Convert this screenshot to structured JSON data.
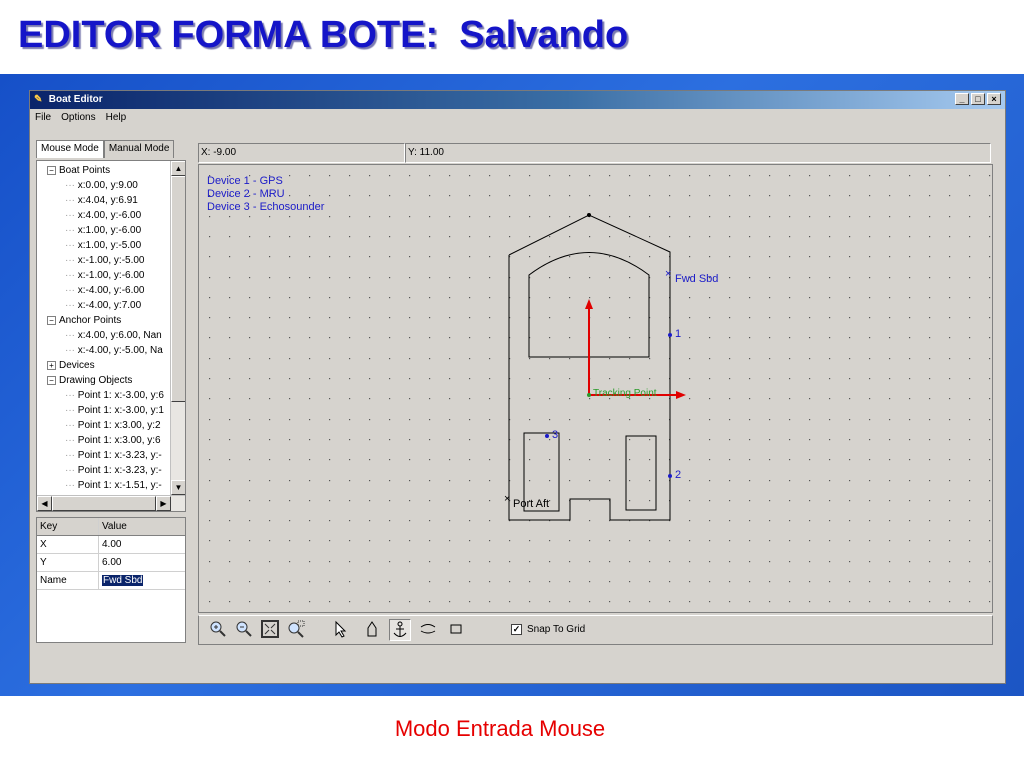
{
  "slide": {
    "title": "EDITOR FORMA BOTE:  Salvando",
    "caption": "Modo Entrada Mouse"
  },
  "window": {
    "title": "Boat Editor",
    "title_icon": "pencil-icon",
    "controls": [
      "_",
      "□",
      "×"
    ]
  },
  "menu": [
    "File",
    "Options",
    "Help"
  ],
  "tabs": [
    "Mouse Mode",
    "Manual Mode"
  ],
  "active_tab": "Mouse Mode",
  "tree": [
    {
      "label": "Boat Points",
      "level": 0,
      "expander": "-"
    },
    {
      "label": "x:0.00, y:9.00",
      "level": 1
    },
    {
      "label": "x:4.04, y:6.91",
      "level": 1
    },
    {
      "label": "x:4.00, y:-6.00",
      "level": 1
    },
    {
      "label": "x:1.00, y:-6.00",
      "level": 1
    },
    {
      "label": "x:1.00, y:-5.00",
      "level": 1
    },
    {
      "label": "x:-1.00, y:-5.00",
      "level": 1
    },
    {
      "label": "x:-1.00, y:-6.00",
      "level": 1
    },
    {
      "label": "x:-4.00, y:-6.00",
      "level": 1
    },
    {
      "label": "x:-4.00, y:7.00",
      "level": 1
    },
    {
      "label": "Anchor Points",
      "level": 0,
      "expander": "-"
    },
    {
      "label": "x:4.00, y:6.00, Nan",
      "level": 1
    },
    {
      "label": "x:-4.00, y:-5.00, Na",
      "level": 1
    },
    {
      "label": "Devices",
      "level": 0,
      "expander": "+"
    },
    {
      "label": "Drawing Objects",
      "level": 0,
      "expander": "-"
    },
    {
      "label": "Point 1: x:-3.00, y:6",
      "level": 1
    },
    {
      "label": "Point 1: x:-3.00, y:1",
      "level": 1
    },
    {
      "label": "Point 1: x:3.00, y:2",
      "level": 1
    },
    {
      "label": "Point 1: x:3.00, y:6",
      "level": 1
    },
    {
      "label": "Point 1: x:-3.23, y:-",
      "level": 1
    },
    {
      "label": "Point 1: x:-3.23, y:-",
      "level": 1
    },
    {
      "label": "Point 1: x:-1.51, y:-",
      "level": 1
    }
  ],
  "properties": {
    "headers": [
      "Key",
      "Value"
    ],
    "rows": [
      {
        "key": "X",
        "value": "4.00"
      },
      {
        "key": "Y",
        "value": "6.00"
      },
      {
        "key": "Name",
        "value": "Fwd Sbd"
      }
    ],
    "selected_row": "Name"
  },
  "coords": {
    "x": "X: -9.00",
    "y": "Y: 11.00"
  },
  "canvas": {
    "devices": [
      "Device 1 - GPS",
      "Device 2 - MRU",
      "Device 3 - Echosounder"
    ],
    "labels": {
      "fwd_sbd": "Fwd Sbd",
      "port_aft": "Port Aft",
      "tracking_point": "Tracking Point",
      "dev1": "1",
      "dev2": "2",
      "dev3": "3"
    },
    "colors": {
      "devices_text": "#1b1bc8",
      "tracking_label": "#2a9a2a",
      "axes": "#e00000",
      "outline": "#000000",
      "grid_dot": "#555555"
    }
  },
  "toolbar": {
    "tools": [
      "zoom-in-icon",
      "zoom-out-icon",
      "zoom-fit-icon",
      "zoom-window-icon",
      "pointer-icon",
      "boat-shape-icon",
      "anchor-icon",
      "arc-icon",
      "rectangle-icon"
    ],
    "active_tool": "anchor-icon",
    "snap_label": "Snap To Grid",
    "snap_checked": true
  }
}
